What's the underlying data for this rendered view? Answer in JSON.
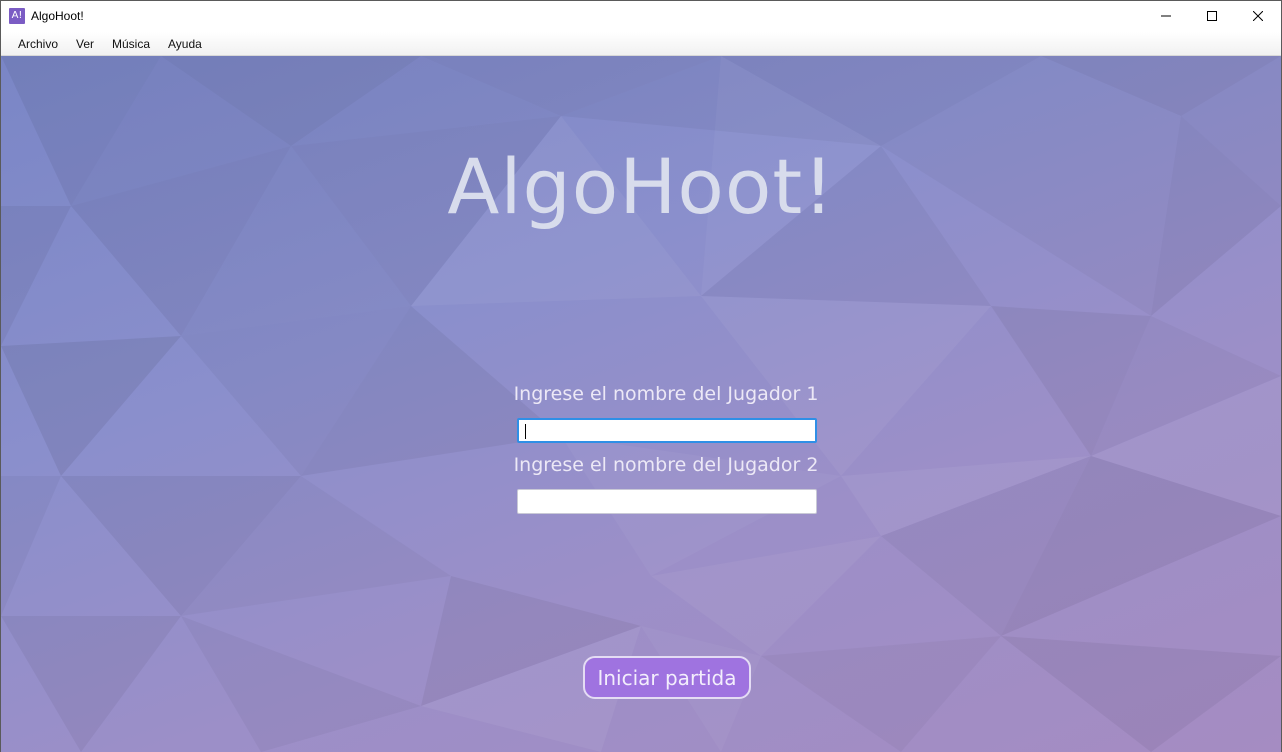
{
  "window": {
    "icon_text": "A!",
    "title": "AlgoHoot!",
    "controls": {
      "minimize_icon": "minimize-icon",
      "maximize_icon": "maximize-icon",
      "close_icon": "close-icon"
    }
  },
  "menubar": {
    "items": [
      {
        "label": "Archivo"
      },
      {
        "label": "Ver"
      },
      {
        "label": "Música"
      },
      {
        "label": "Ayuda"
      }
    ]
  },
  "main": {
    "title": "AlgoHoot!",
    "player1": {
      "label": "Ingrese el nombre del Jugador 1",
      "value": "",
      "placeholder": ""
    },
    "player2": {
      "label": "Ingrese el nombre del Jugador 2",
      "value": "",
      "placeholder": ""
    },
    "start_button": "Iniciar partida"
  },
  "colors": {
    "background_top": "#7a86c6",
    "background_bottom": "#a58cc2",
    "button": "#9f73e0",
    "focus_border": "#2f8fe6"
  }
}
